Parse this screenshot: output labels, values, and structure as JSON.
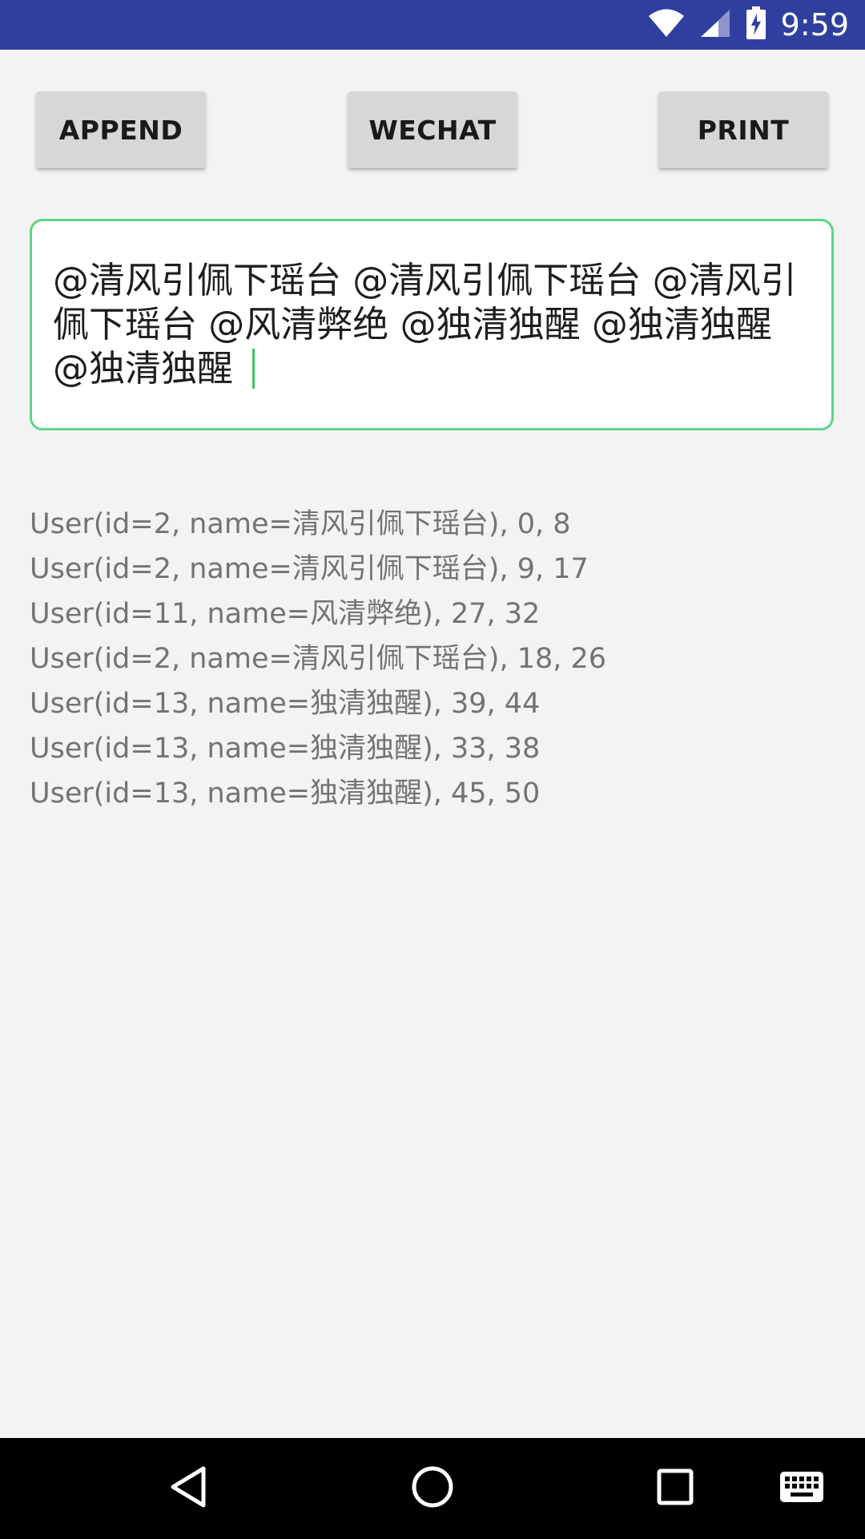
{
  "status_bar": {
    "time": "9:59",
    "icons": [
      "wifi-icon",
      "signal-icon",
      "battery-charging-icon"
    ],
    "background": "#303f9f"
  },
  "toolbar": {
    "append_label": "APPEND",
    "wechat_label": "WECHAT",
    "print_label": "PRINT"
  },
  "editor": {
    "value": "@清风引佩下瑶台 @清风引佩下瑶台 @清风引佩下瑶台 @风清弊绝 @独清独醒 @独清独醒 @独清独醒 ",
    "border_color": "#5fd487"
  },
  "log": {
    "lines": [
      "User(id=2, name=清风引佩下瑶台), 0, 8",
      "User(id=2, name=清风引佩下瑶台), 9, 17",
      "User(id=11, name=风清弊绝), 27, 32",
      "User(id=2, name=清风引佩下瑶台), 18, 26",
      "User(id=13, name=独清独醒), 39, 44",
      "User(id=13, name=独清独醒), 33, 38",
      "User(id=13, name=独清独醒), 45, 50"
    ]
  },
  "nav_bar": {
    "buttons": [
      "back-icon",
      "home-icon",
      "recents-icon",
      "keyboard-icon"
    ]
  }
}
